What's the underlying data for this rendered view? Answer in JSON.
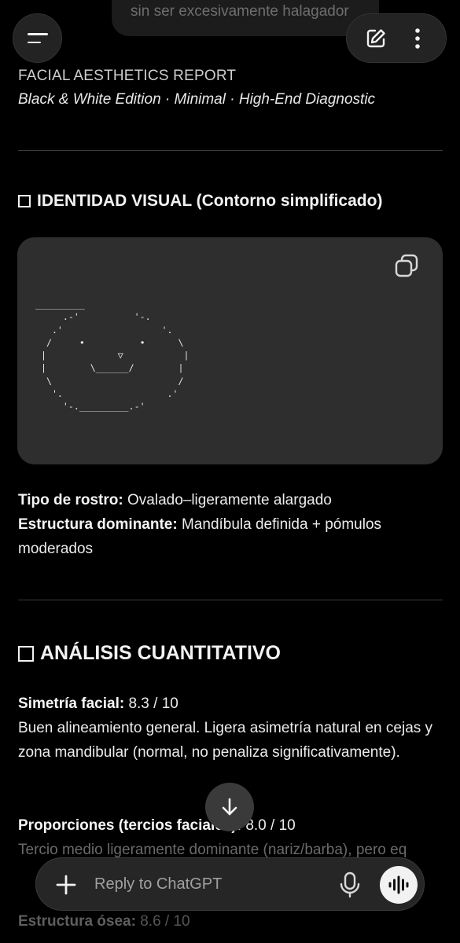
{
  "top_bubble": {
    "text": "sin ser excesivamente halagador"
  },
  "header": {
    "menu_icon": "menu-icon",
    "edit_icon": "edit-icon",
    "more_icon": "more-vertical-icon"
  },
  "report": {
    "title": "FACIAL AESTHETICS REPORT",
    "subtitle": "Black & White Edition · Minimal · High-End Diagnostic"
  },
  "section1": {
    "heading": "IDENTIDAD VISUAL (Contorno simplificado)",
    "code": "_________\n     .-'          '-.\n   .'                  '.\n  /     •          •      \\\n |             ▽           |\n |        \\______/        |\n  \\                       /\n   '.                   .'\n     '-._________.-'",
    "face_type_label": "Tipo de rostro:",
    "face_type_value": " Ovalado–ligeramente alargado",
    "structure_label": "Estructura dominante:",
    "structure_value": " Mandíbula definida + pómulos moderados"
  },
  "section2": {
    "heading": "ANÁLISIS CUANTITATIVO",
    "symmetry_label": "Simetría facial:",
    "symmetry_value": " 8.3 / 10",
    "symmetry_text": "Buen alineamiento general. Ligera asimetría natural en cejas y zona mandibular (normal, no penaliza significativamente).",
    "proportions_label": "Proporciones (tercios faciales):",
    "proportions_value": " 8.0 / 10",
    "proportions_text": "Tercio medio ligeramente dominante (nariz/barba), pero eq",
    "bone_label": "Estructura ósea:",
    "bone_value": " 8.6 / 10"
  },
  "composer": {
    "placeholder": "Reply to ChatGPT"
  }
}
